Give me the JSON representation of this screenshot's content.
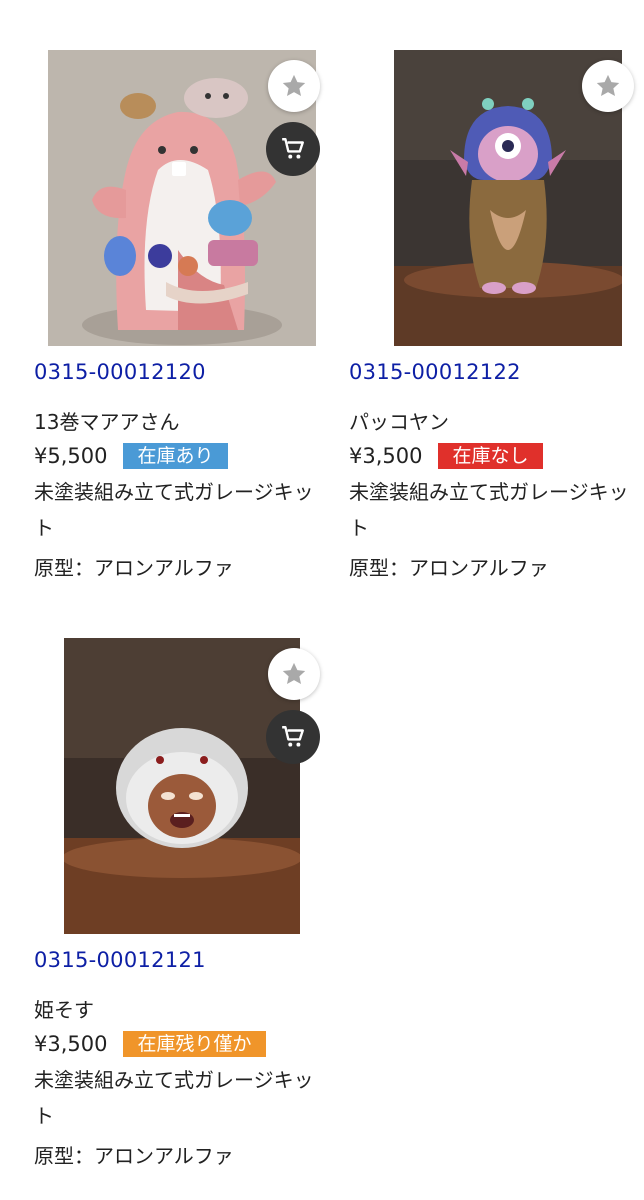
{
  "products": [
    {
      "code": "0315-00012120",
      "name": "13巻マアアさん",
      "price": "¥5,500",
      "stock_label": "在庫あり",
      "stock_color": "#4a9ad6",
      "description": "未塗装組み立て式ガレージキット",
      "sculptor": "原型：アロンアルファ",
      "image": "pink-creature-figure-photo"
    },
    {
      "code": "0315-00012122",
      "name": "パッコヤン",
      "price": "¥3,500",
      "stock_label": "在庫なし",
      "stock_color": "#e0302b",
      "description": "未塗装組み立て式ガレージキット",
      "sculptor": "原型：アロンアルファ",
      "image": "one-eyed-girl-figure-photo"
    },
    {
      "code": "0315-00012121",
      "name": "姫そす",
      "price": "¥3,500",
      "stock_label": "在庫残り僅か",
      "stock_color": "#f0952a",
      "description": "未塗装組み立て式ガレージキット",
      "sculptor": "原型：アロンアルファ",
      "image": "fluffy-head-figure-photo"
    }
  ],
  "icons": {
    "favorite": "star-icon",
    "cart": "cart-icon"
  }
}
